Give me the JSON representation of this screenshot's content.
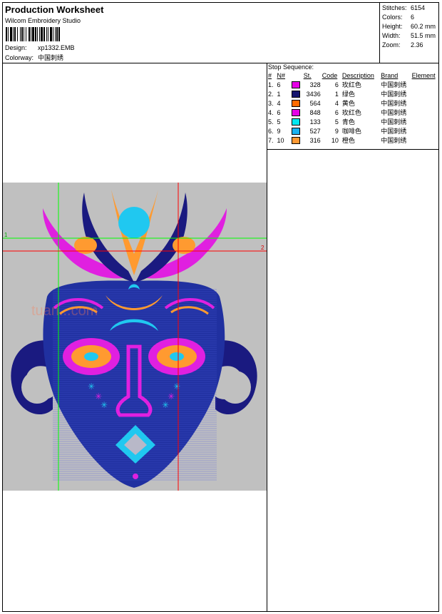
{
  "header": {
    "title": "Production Worksheet",
    "software": "Wilcom Embroidery Studio",
    "design_label": "Design:",
    "design_value": "xp1332.EMB",
    "colorway_label": "Colorway:",
    "colorway_value": "中国刺绣"
  },
  "stats": [
    {
      "label": "Stitches:",
      "value": "6154"
    },
    {
      "label": "Colors:",
      "value": "6"
    },
    {
      "label": "Height:",
      "value": "60.2 mm"
    },
    {
      "label": "Width:",
      "value": "51.5 mm"
    },
    {
      "label": "Zoom:",
      "value": "2.36"
    }
  ],
  "stop_sequence": {
    "title": "Stop Sequence:",
    "columns": [
      "#",
      "N#",
      "St.",
      "Code",
      "Description",
      "Brand",
      "Element"
    ],
    "rows": [
      {
        "num": "1.",
        "n": "6",
        "color": "#e600e6",
        "st": "328",
        "code": "6",
        "desc": "玫红色",
        "brand": "中国刺绣"
      },
      {
        "num": "2.",
        "n": "1",
        "color": "#15156e",
        "st": "3436",
        "code": "1",
        "desc": "绿色",
        "brand": "中国刺绣"
      },
      {
        "num": "3.",
        "n": "4",
        "color": "#ff6a00",
        "st": "564",
        "code": "4",
        "desc": "黄色",
        "brand": "中国刺绣"
      },
      {
        "num": "4.",
        "n": "6",
        "color": "#e600e6",
        "st": "848",
        "code": "6",
        "desc": "玫红色",
        "brand": "中国刺绣"
      },
      {
        "num": "5.",
        "n": "5",
        "color": "#00e8f0",
        "st": "133",
        "code": "5",
        "desc": "青色",
        "brand": "中国刺绣"
      },
      {
        "num": "6.",
        "n": "9",
        "color": "#1ab2f0",
        "st": "527",
        "code": "9",
        "desc": "咖啡色",
        "brand": "中国刺绣"
      },
      {
        "num": "7.",
        "n": "10",
        "color": "#ff9933",
        "st": "316",
        "code": "10",
        "desc": "橙色",
        "brand": "中国刺绣"
      }
    ]
  },
  "preview": {
    "marker_1": "1",
    "marker_2": "2",
    "watermark": "tuan...com",
    "colors": {
      "navy": "#1a1a80",
      "magenta": "#e020e0",
      "orange": "#ff9a30",
      "cyan": "#20c8f0",
      "grey": "#c0c0c0",
      "green_guide": "#00ff00",
      "red_guide": "#ff0000"
    }
  }
}
